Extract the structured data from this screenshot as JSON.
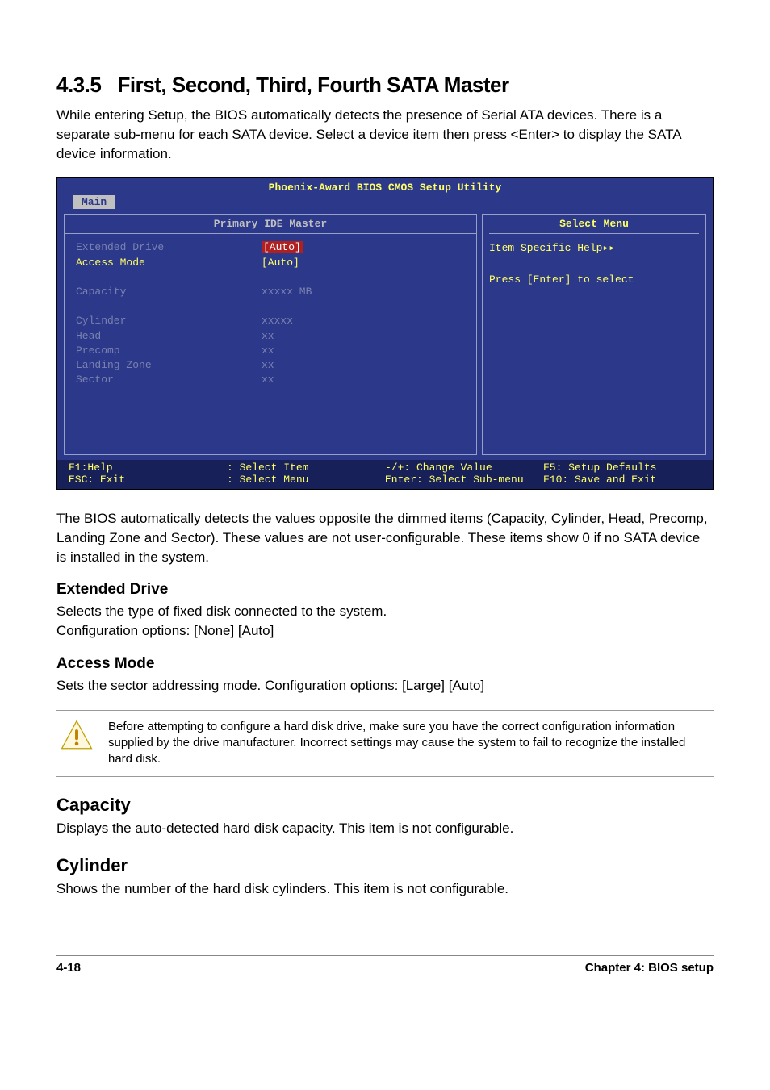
{
  "section": {
    "number": "4.3.5",
    "title": "First, Second, Third, Fourth SATA Master",
    "intro": "While entering Setup, the BIOS automatically detects the presence of Serial ATA devices. There is a separate sub-menu for each SATA device. Select a device item then press <Enter> to display the SATA device information."
  },
  "bios": {
    "title": "Phoenix-Award BIOS CMOS Setup Utility",
    "active_tab": "Main",
    "left_header": "Primary IDE Master",
    "right_header": "Select Menu",
    "rows": [
      {
        "label": "Extended Drive",
        "value": "[Auto]",
        "dim": true,
        "selected": true
      },
      {
        "label": "Access Mode",
        "value": "[Auto]",
        "gold": true
      },
      {
        "label": "",
        "value": ""
      },
      {
        "label": "Capacity",
        "value": "xxxxx MB",
        "dim": true
      },
      {
        "label": "",
        "value": ""
      },
      {
        "label": "Cylinder",
        "value": "xxxxx",
        "dim": true
      },
      {
        "label": "Head",
        "value": "   xx",
        "dim": true
      },
      {
        "label": "Precomp",
        "value": "   xx",
        "dim": true
      },
      {
        "label": "Landing Zone",
        "value": "   xx",
        "dim": true
      },
      {
        "label": "Sector",
        "value": "   xx",
        "dim": true
      }
    ],
    "help_panel": {
      "line1": "Item Specific Help",
      "line2": "Press [Enter] to select"
    },
    "footer": {
      "c1a": "F1:Help",
      "c1b": "ESC: Exit",
      "c2a": ": Select Item",
      "c2b": ": Select Menu",
      "c3a": "-/+: Change Value",
      "c3b": "Enter: Select Sub-menu",
      "c4a": "F5: Setup Defaults",
      "c4b": "F10: Save and Exit"
    }
  },
  "after_bios": "The BIOS automatically detects the values opposite the dimmed items (Capacity, Cylinder,  Head, Precomp, Landing Zone and Sector). These values are not user-configurable. These items show 0 if no SATA device is installed in the system.",
  "subsections": {
    "extended_drive": {
      "title": "Extended Drive",
      "body": "Selects the type of fixed disk connected to the system.\nConfiguration options: [None] [Auto]"
    },
    "access_mode": {
      "title": "Access Mode",
      "body": "Sets the sector addressing mode. Configuration options: [Large] [Auto]"
    },
    "note": "Before attempting to configure a hard disk drive, make sure you have the correct configuration information supplied by the drive manufacturer. Incorrect settings may cause the system to fail to recognize the installed hard disk.",
    "capacity": {
      "title": "Capacity",
      "body": "Displays the auto-detected hard disk capacity. This item is not configurable."
    },
    "cylinder": {
      "title": "Cylinder",
      "body": "Shows the number of the hard disk cylinders. This item is not configurable."
    }
  },
  "footer": {
    "left": "4-18",
    "right": "Chapter 4: BIOS setup"
  }
}
